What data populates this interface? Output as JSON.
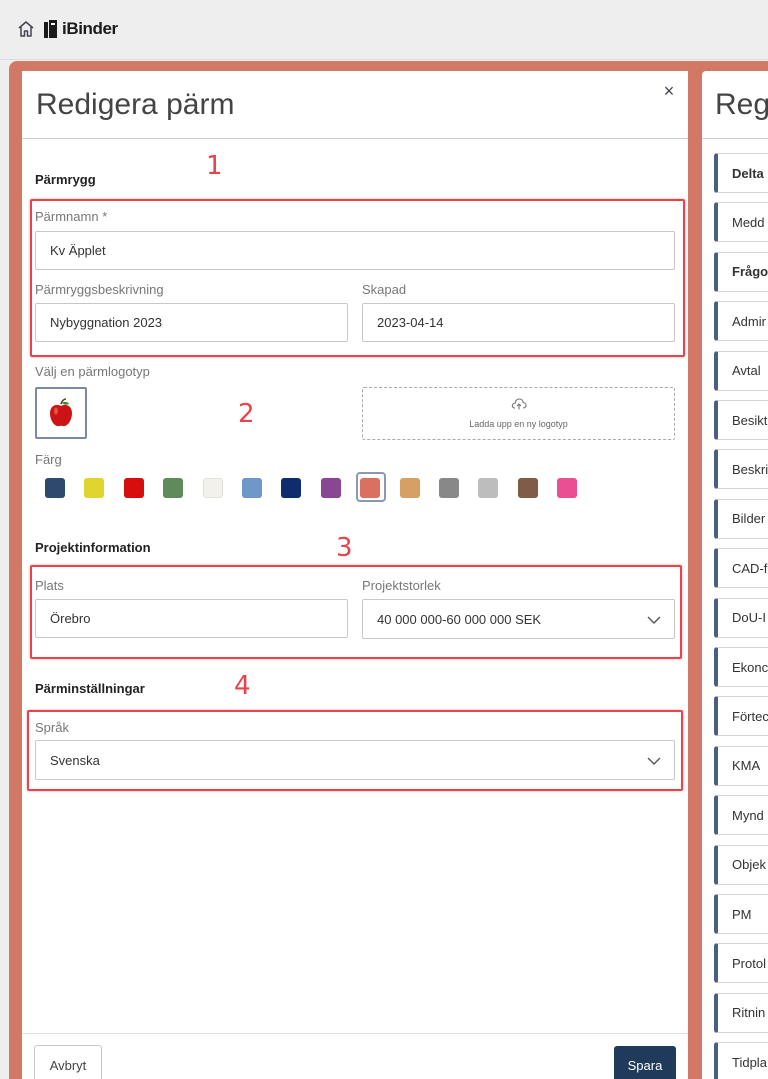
{
  "app": {
    "name": "iBinder"
  },
  "dialog": {
    "title": "Redigera pärm",
    "close_label": "×",
    "sections": {
      "binder_spine": "Pärmrygg",
      "project_info": "Projektinformation",
      "binder_settings": "Pärminställningar"
    },
    "binder_name": {
      "label": "Pärmnamn *",
      "value": "Kv Äpplet"
    },
    "spine_description": {
      "label": "Pärmryggsbeskrivning",
      "value": "Nybyggnation 2023"
    },
    "created": {
      "label": "Skapad",
      "value": "2023-04-14"
    },
    "logo": {
      "label": "Välj en pärmlogotyp",
      "upload_text": "Ladda upp en ny logotyp"
    },
    "color": {
      "label": "Färg",
      "swatches": [
        "#2d4a6c",
        "#dfd52e",
        "#d60e0e",
        "#5e8a5c",
        "#f3f1ec",
        "#6e98c7",
        "#0d2d6d",
        "#8a4593",
        "#d97060",
        "#d6a065",
        "#888888",
        "#bdbdbd",
        "#7f5c45",
        "#ea4f94"
      ],
      "selected_index": 8
    },
    "location": {
      "label": "Plats",
      "value": "Örebro"
    },
    "project_size": {
      "label": "Projektstorlek",
      "value": "40 000 000-60 000 000 SEK"
    },
    "language": {
      "label": "Språk",
      "value": "Svenska"
    },
    "buttons": {
      "cancel": "Avbryt",
      "save": "Spara"
    }
  },
  "annotations": [
    "1",
    "2",
    "3",
    "4"
  ],
  "right_panel": {
    "title": "Regi",
    "items": [
      {
        "label": "Delta",
        "bold": true
      },
      {
        "label": "Medd",
        "bold": false
      },
      {
        "label": "Frågo",
        "bold": true
      },
      {
        "label": "Admir",
        "bold": false
      },
      {
        "label": "Avtal",
        "bold": false
      },
      {
        "label": "Besikt",
        "bold": false
      },
      {
        "label": "Beskri",
        "bold": false
      },
      {
        "label": "Bilder",
        "bold": false
      },
      {
        "label": "CAD-f",
        "bold": false
      },
      {
        "label": "DoU-I",
        "bold": false
      },
      {
        "label": "Ekonc",
        "bold": false
      },
      {
        "label": "Förtec",
        "bold": false
      },
      {
        "label": "KMA",
        "bold": false
      },
      {
        "label": "Mynd",
        "bold": false
      },
      {
        "label": "Objek",
        "bold": false
      },
      {
        "label": "PM",
        "bold": false
      },
      {
        "label": "Protol",
        "bold": false
      },
      {
        "label": "Ritnin",
        "bold": false
      },
      {
        "label": "Tidpla",
        "bold": false
      }
    ]
  }
}
